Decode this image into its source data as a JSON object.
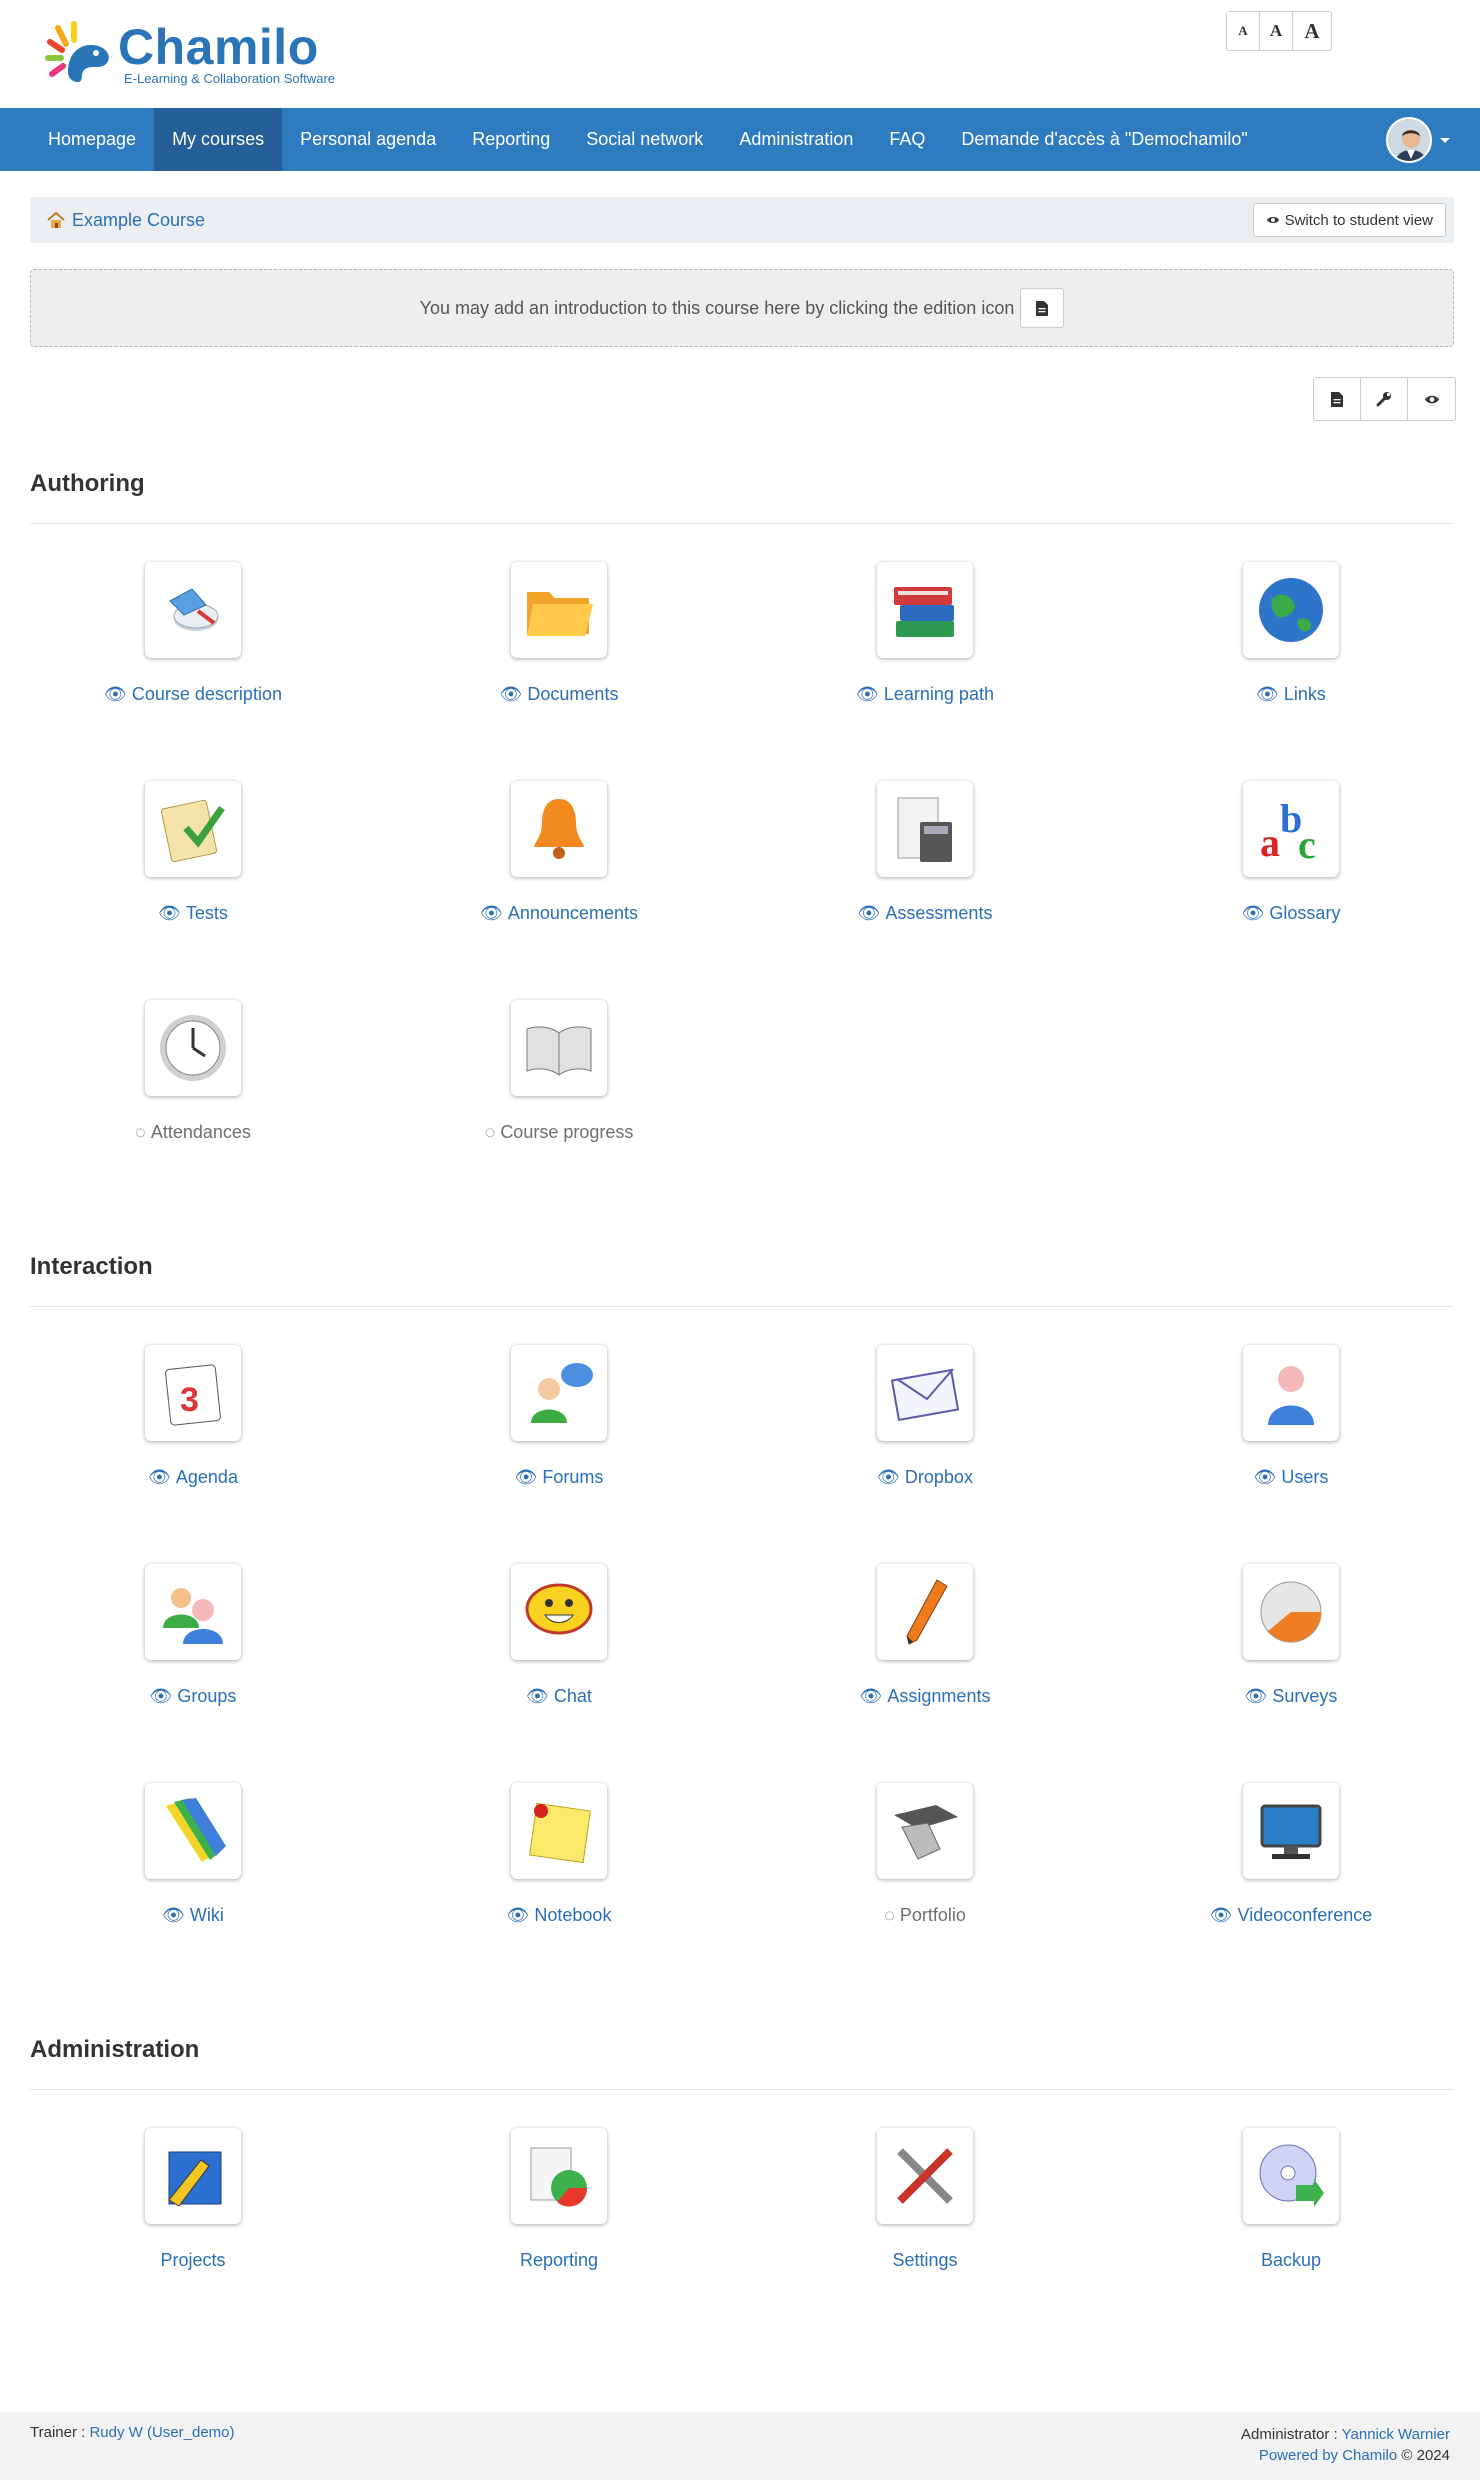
{
  "logo": {
    "name": "Chamilo",
    "tagline": "E-Learning & Collaboration Software"
  },
  "font_sizer": [
    "A",
    "A",
    "A"
  ],
  "nav": {
    "items": [
      {
        "label": "Homepage",
        "active": false
      },
      {
        "label": "My courses",
        "active": true
      },
      {
        "label": "Personal agenda",
        "active": false
      },
      {
        "label": "Reporting",
        "active": false
      },
      {
        "label": "Social network",
        "active": false
      },
      {
        "label": "Administration",
        "active": false
      },
      {
        "label": "FAQ",
        "active": false
      },
      {
        "label": "Demande d'accès à \"Demochamilo\"",
        "active": false
      }
    ]
  },
  "breadcrumb": {
    "course": "Example Course",
    "switch_label": "Switch to student view"
  },
  "intro": {
    "text": "You may add an introduction to this course here by clicking the edition icon"
  },
  "sections": [
    {
      "title": "Authoring",
      "tools": [
        {
          "label": "Course description",
          "visible": true,
          "icon": "course-description-icon"
        },
        {
          "label": "Documents",
          "visible": true,
          "icon": "documents-folder-icon"
        },
        {
          "label": "Learning path",
          "visible": true,
          "icon": "learning-path-books-icon"
        },
        {
          "label": "Links",
          "visible": true,
          "icon": "links-globe-icon"
        },
        {
          "label": "Tests",
          "visible": true,
          "icon": "tests-checklist-icon"
        },
        {
          "label": "Announcements",
          "visible": true,
          "icon": "announcements-bell-icon"
        },
        {
          "label": "Assessments",
          "visible": true,
          "icon": "assessments-calculator-icon"
        },
        {
          "label": "Glossary",
          "visible": true,
          "icon": "glossary-abc-icon"
        },
        {
          "label": "Attendances",
          "visible": false,
          "icon": "attendances-clock-icon"
        },
        {
          "label": "Course progress",
          "visible": false,
          "icon": "course-progress-book-icon"
        }
      ]
    },
    {
      "title": "Interaction",
      "tools": [
        {
          "label": "Agenda",
          "visible": true,
          "icon": "agenda-calendar-icon"
        },
        {
          "label": "Forums",
          "visible": true,
          "icon": "forums-user-bubble-icon"
        },
        {
          "label": "Dropbox",
          "visible": true,
          "icon": "dropbox-envelope-icon"
        },
        {
          "label": "Users",
          "visible": true,
          "icon": "users-person-icon"
        },
        {
          "label": "Groups",
          "visible": true,
          "icon": "groups-people-icon"
        },
        {
          "label": "Chat",
          "visible": true,
          "icon": "chat-smiley-icon"
        },
        {
          "label": "Assignments",
          "visible": true,
          "icon": "assignments-pen-icon"
        },
        {
          "label": "Surveys",
          "visible": true,
          "icon": "surveys-pie-icon"
        },
        {
          "label": "Wiki",
          "visible": true,
          "icon": "wiki-pencils-icon"
        },
        {
          "label": "Notebook",
          "visible": true,
          "icon": "notebook-note-icon"
        },
        {
          "label": "Portfolio",
          "visible": false,
          "icon": "portfolio-cap-icon"
        },
        {
          "label": "Videoconference",
          "visible": true,
          "icon": "videoconference-monitor-icon"
        }
      ]
    },
    {
      "title": "Administration",
      "tools": [
        {
          "label": "Projects",
          "visible": null,
          "icon": "projects-pen-icon"
        },
        {
          "label": "Reporting",
          "visible": null,
          "icon": "reporting-chart-icon"
        },
        {
          "label": "Settings",
          "visible": null,
          "icon": "settings-tools-icon"
        },
        {
          "label": "Backup",
          "visible": null,
          "icon": "backup-disc-icon"
        }
      ]
    }
  ],
  "footer": {
    "trainer_label": "Trainer :",
    "trainer_name": "Rudy W (User_demo)",
    "admin_label": "Administrator :",
    "admin_name": "Yannick Warnier",
    "powered_link": "Powered by Chamilo",
    "copyright": "© 2024"
  },
  "colors": {
    "nav": "#2f7bbf",
    "nav_active": "#245f97",
    "link": "#2a6fb5",
    "muted": "#6f6f6f"
  }
}
